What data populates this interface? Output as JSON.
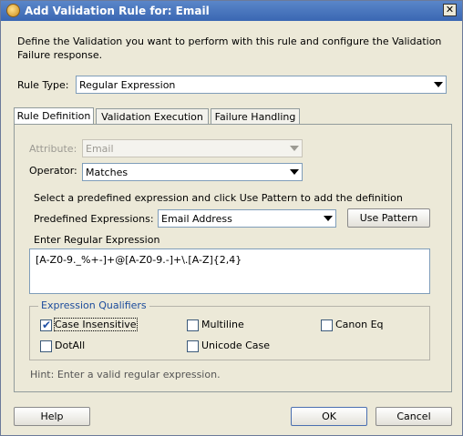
{
  "window": {
    "title": "Add Validation Rule for: Email",
    "close_glyph": "✕"
  },
  "description": "Define the Validation you want to perform with this rule and configure the Validation Failure response.",
  "rule_type": {
    "label": "Rule Type:",
    "value": "Regular Expression"
  },
  "tabs": [
    {
      "label": "Rule Definition",
      "active": true
    },
    {
      "label": "Validation Execution",
      "active": false
    },
    {
      "label": "Failure Handling",
      "active": false
    }
  ],
  "attribute": {
    "label": "Attribute:",
    "value": "Email",
    "enabled": false
  },
  "operator": {
    "label": "Operator:",
    "value": "Matches"
  },
  "predefined_instruction": "Select a predefined expression and click Use Pattern to add the definition",
  "predefined": {
    "label": "Predefined Expressions:",
    "value": "Email Address",
    "button": "Use Pattern"
  },
  "regex": {
    "label": "Enter Regular Expression",
    "value": "[A-Z0-9._%+-]+@[A-Z0-9.-]+\\.[A-Z]{2,4}"
  },
  "qualifiers": {
    "title": "Expression Qualifiers",
    "items": [
      {
        "label": "Case Insensitive",
        "checked": true
      },
      {
        "label": "Multiline",
        "checked": false
      },
      {
        "label": "Canon Eq",
        "checked": false
      },
      {
        "label": "DotAll",
        "checked": false
      },
      {
        "label": "Unicode Case",
        "checked": false
      }
    ]
  },
  "hint": "Hint: Enter a valid regular expression.",
  "buttons": {
    "help": "Help",
    "ok": "OK",
    "cancel": "Cancel"
  },
  "colors": {
    "titlebar": "#3a67b3",
    "dialog_bg": "#ece9d8",
    "accent_text": "#1c4c9c"
  },
  "check_glyph": "✔"
}
